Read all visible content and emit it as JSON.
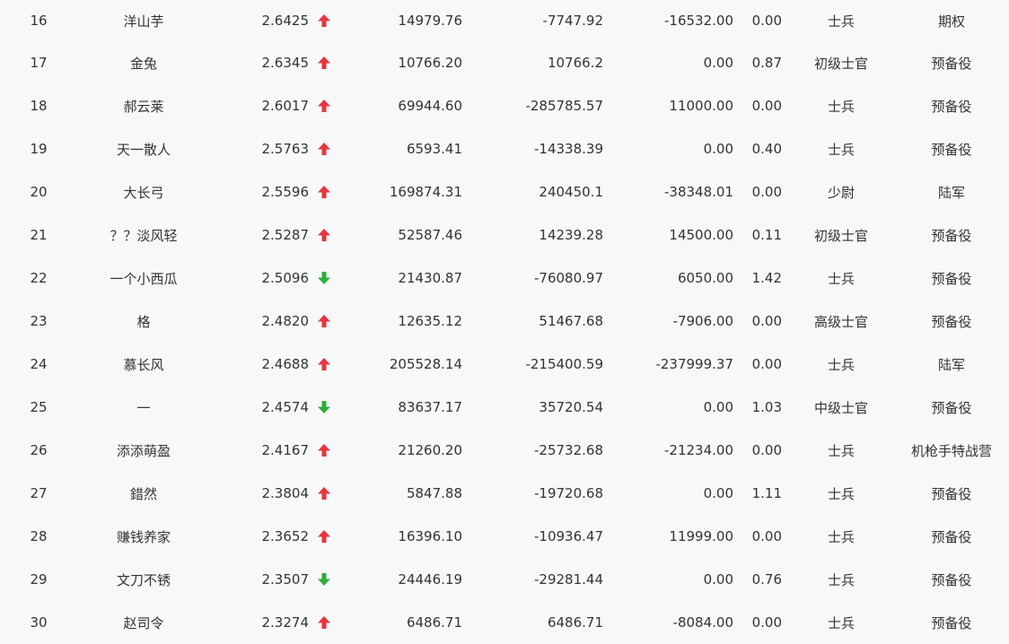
{
  "table": {
    "colors": {
      "up": "#e8353d",
      "down": "#2eae3c",
      "text": "#333333",
      "background": "#f7f8fa"
    },
    "rows": [
      {
        "rank": "16",
        "name": "洋山芋",
        "ratio": "2.6425",
        "trend": "up",
        "v1": "14979.76",
        "v2": "-7747.92",
        "v3": "-16532.00",
        "v4": "0.00",
        "military_rank": "士兵",
        "unit": "期权"
      },
      {
        "rank": "17",
        "name": "金兔",
        "ratio": "2.6345",
        "trend": "up",
        "v1": "10766.20",
        "v2": "10766.2",
        "v3": "0.00",
        "v4": "0.87",
        "military_rank": "初级士官",
        "unit": "预备役"
      },
      {
        "rank": "18",
        "name": "郝云莱",
        "ratio": "2.6017",
        "trend": "up",
        "v1": "69944.60",
        "v2": "-285785.57",
        "v3": "11000.00",
        "v4": "0.00",
        "military_rank": "士兵",
        "unit": "预备役"
      },
      {
        "rank": "19",
        "name": "天一散人",
        "ratio": "2.5763",
        "trend": "up",
        "v1": "6593.41",
        "v2": "-14338.39",
        "v3": "0.00",
        "v4": "0.40",
        "military_rank": "士兵",
        "unit": "预备役"
      },
      {
        "rank": "20",
        "name": "大长弓",
        "ratio": "2.5596",
        "trend": "up",
        "v1": "169874.31",
        "v2": "240450.1",
        "v3": "-38348.01",
        "v4": "0.00",
        "military_rank": "少尉",
        "unit": "陆军"
      },
      {
        "rank": "21",
        "name": "？？淡风轻",
        "ratio": "2.5287",
        "trend": "up",
        "v1": "52587.46",
        "v2": "14239.28",
        "v3": "14500.00",
        "v4": "0.11",
        "military_rank": "初级士官",
        "unit": "预备役"
      },
      {
        "rank": "22",
        "name": "一个小西瓜",
        "ratio": "2.5096",
        "trend": "down",
        "v1": "21430.87",
        "v2": "-76080.97",
        "v3": "6050.00",
        "v4": "1.42",
        "military_rank": "士兵",
        "unit": "预备役"
      },
      {
        "rank": "23",
        "name": "格",
        "ratio": "2.4820",
        "trend": "up",
        "v1": "12635.12",
        "v2": "51467.68",
        "v3": "-7906.00",
        "v4": "0.00",
        "military_rank": "高级士官",
        "unit": "预备役"
      },
      {
        "rank": "24",
        "name": "慕长风",
        "ratio": "2.4688",
        "trend": "up",
        "v1": "205528.14",
        "v2": "-215400.59",
        "v3": "-237999.37",
        "v4": "0.00",
        "military_rank": "士兵",
        "unit": "陆军"
      },
      {
        "rank": "25",
        "name": "一",
        "ratio": "2.4574",
        "trend": "down",
        "v1": "83637.17",
        "v2": "35720.54",
        "v3": "0.00",
        "v4": "1.03",
        "military_rank": "中级士官",
        "unit": "预备役"
      },
      {
        "rank": "26",
        "name": "添添萌盈",
        "ratio": "2.4167",
        "trend": "up",
        "v1": "21260.20",
        "v2": "-25732.68",
        "v3": "-21234.00",
        "v4": "0.00",
        "military_rank": "士兵",
        "unit": "机枪手特战营"
      },
      {
        "rank": "27",
        "name": "錯然",
        "ratio": "2.3804",
        "trend": "up",
        "v1": "5847.88",
        "v2": "-19720.68",
        "v3": "0.00",
        "v4": "1.11",
        "military_rank": "士兵",
        "unit": "预备役"
      },
      {
        "rank": "28",
        "name": "赚钱养家",
        "ratio": "2.3652",
        "trend": "up",
        "v1": "16396.10",
        "v2": "-10936.47",
        "v3": "11999.00",
        "v4": "0.00",
        "military_rank": "士兵",
        "unit": "预备役"
      },
      {
        "rank": "29",
        "name": "文刀不锈",
        "ratio": "2.3507",
        "trend": "down",
        "v1": "24446.19",
        "v2": "-29281.44",
        "v3": "0.00",
        "v4": "0.76",
        "military_rank": "士兵",
        "unit": "预备役"
      },
      {
        "rank": "30",
        "name": "赵司令",
        "ratio": "2.3274",
        "trend": "up",
        "v1": "6486.71",
        "v2": "6486.71",
        "v3": "-8084.00",
        "v4": "0.00",
        "military_rank": "士兵",
        "unit": "预备役"
      }
    ]
  }
}
